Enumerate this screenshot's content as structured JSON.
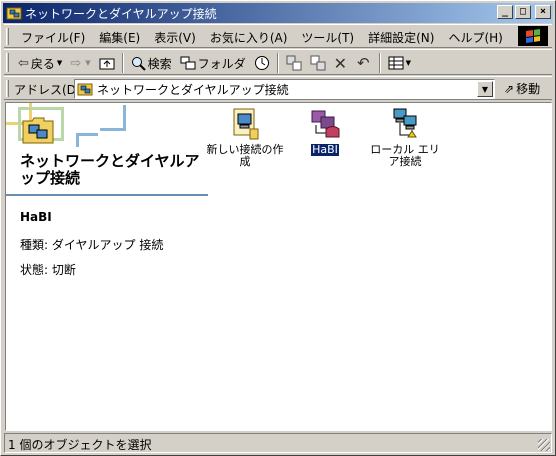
{
  "window": {
    "title": "ネットワークとダイヤルアップ接続",
    "controls": {
      "minimize": "_",
      "maximize": "□",
      "close": "×"
    }
  },
  "menubar": {
    "items": [
      "ファイル(F)",
      "編集(E)",
      "表示(V)",
      "お気に入り(A)",
      "ツール(T)",
      "詳細設定(N)",
      "ヘルプ(H)"
    ]
  },
  "toolbar": {
    "back_label": "戻る",
    "search_label": "検索",
    "folders_label": "フォルダ",
    "icons": {
      "back": "back-arrow-icon",
      "forward": "forward-arrow-icon",
      "up": "up-folder-icon",
      "search": "search-icon",
      "folders": "folders-icon",
      "history": "history-icon",
      "move_to": "move-to-icon",
      "copy_to": "copy-to-icon",
      "delete": "delete-icon",
      "undo": "undo-icon",
      "views": "views-icon"
    }
  },
  "address": {
    "label": "アドレス(D)",
    "value": "ネットワークとダイヤルアップ接続",
    "go_label": "移動"
  },
  "left_pane": {
    "title": "ネットワークとダイヤルアップ接続",
    "selected_name": "HaBI",
    "type_line": "種類: ダイヤルアップ 接続",
    "status_line": "状態: 切断"
  },
  "items": [
    {
      "label": "新しい接続の作成",
      "icon": "new-connection-icon",
      "selected": false
    },
    {
      "label": "HaBI",
      "icon": "dialup-connection-icon",
      "selected": true
    },
    {
      "label": "ローカル エリア接続",
      "icon": "lan-connection-icon",
      "selected": false
    }
  ],
  "status": {
    "text": "1 個のオブジェクトを選択"
  },
  "colors": {
    "titlebar_start": "#0a246a",
    "titlebar_end": "#a6caf0",
    "selection": "#0a246a",
    "chrome": "#d4d0c8",
    "rule": "#6b8cb5"
  }
}
